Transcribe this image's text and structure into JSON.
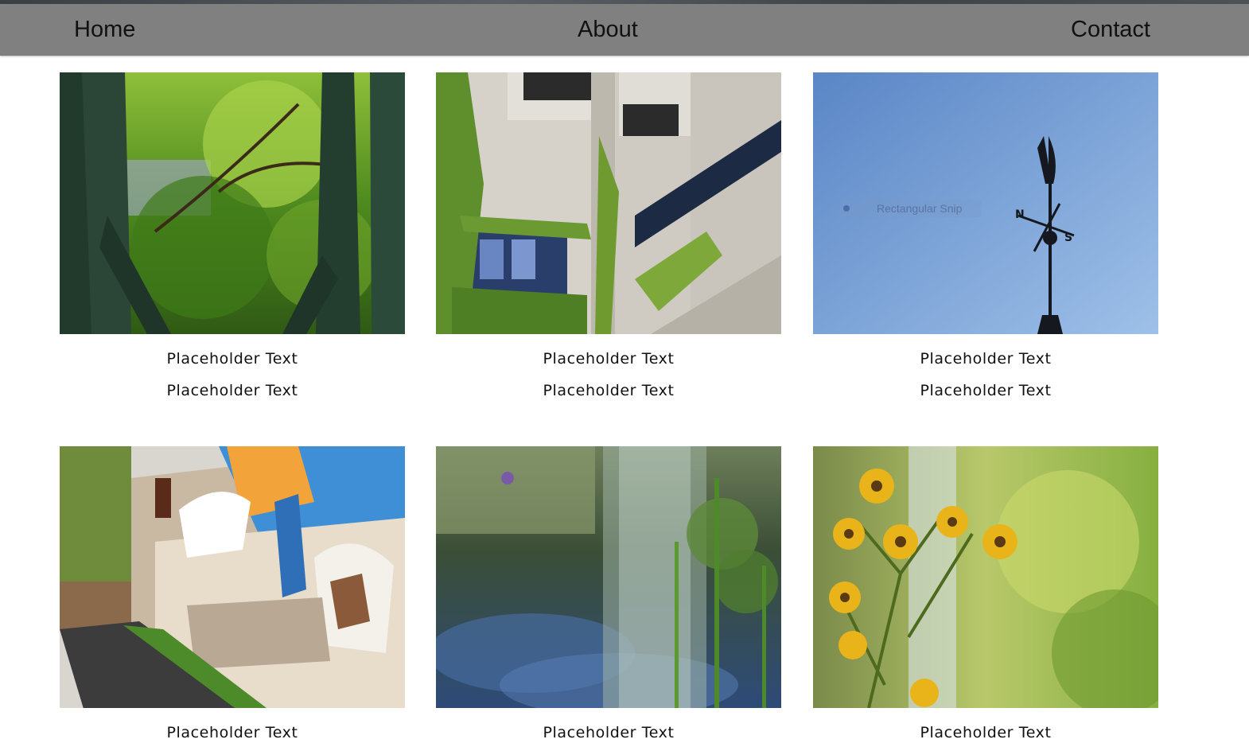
{
  "nav": {
    "home": "Home",
    "about": "About",
    "contact": "Contact"
  },
  "overlay": {
    "snip_label": "Rectangular Snip"
  },
  "cards": [
    {
      "photo": "tree-through-fence-photo",
      "line1": "Placeholder Text",
      "line2": "Placeholder Text"
    },
    {
      "photo": "ivy-covered-building-photo",
      "line1": "Placeholder Text",
      "line2": "Placeholder Text"
    },
    {
      "photo": "weather-vane-sky-photo",
      "line1": "Placeholder Text",
      "line2": "Placeholder Text"
    },
    {
      "photo": "graffiti-wall-alley-photo",
      "line1": "Placeholder Text"
    },
    {
      "photo": "fountain-pond-photo",
      "line1": "Placeholder Text"
    },
    {
      "photo": "yellow-flowers-waterfall-photo",
      "line1": "Placeholder Text"
    }
  ],
  "colors": {
    "navbar": "#808080",
    "page_background": "#ffffff"
  }
}
